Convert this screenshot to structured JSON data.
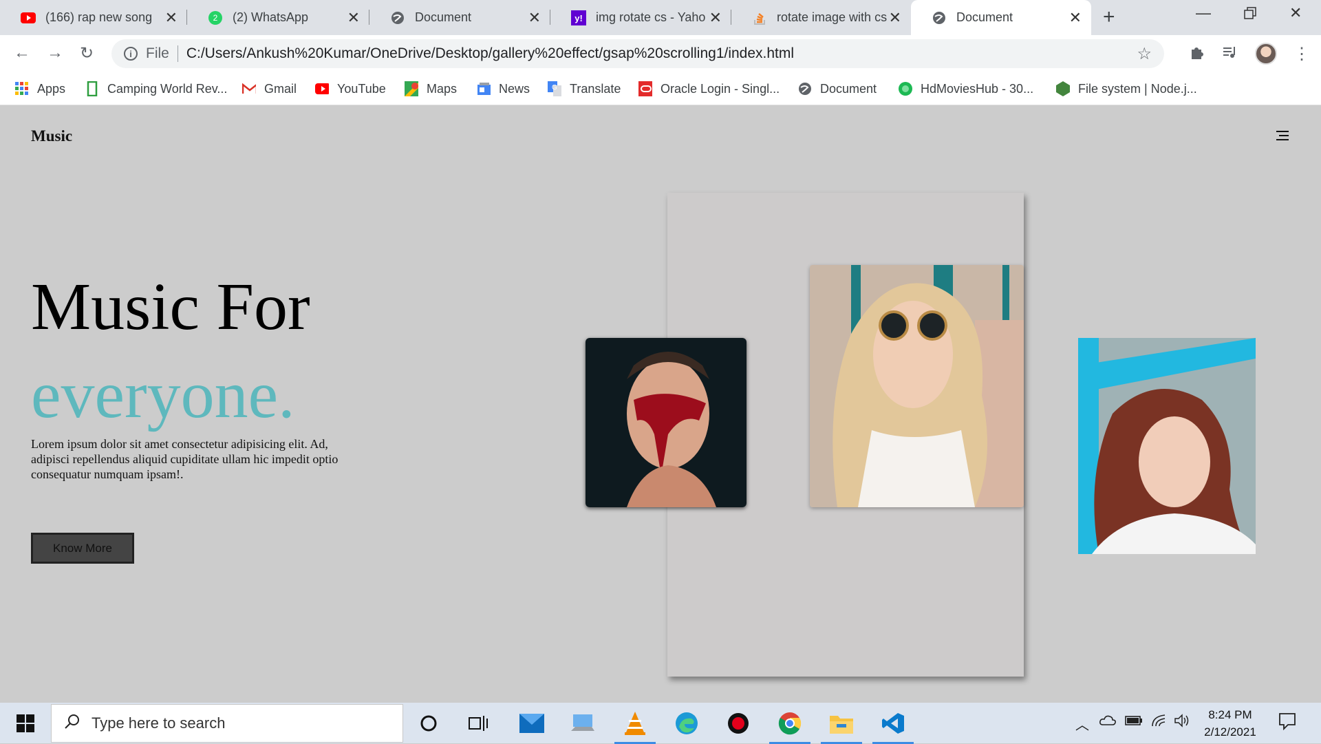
{
  "browser": {
    "tabs": [
      {
        "title": "(166) rap new song -",
        "icon": "youtube-icon"
      },
      {
        "title": "(2) WhatsApp",
        "icon": "whatsapp-icon"
      },
      {
        "title": "Document",
        "icon": "globe-icon"
      },
      {
        "title": "img rotate cs - Yahoo",
        "icon": "yahoo-icon"
      },
      {
        "title": "rotate image with css",
        "icon": "stackoverflow-icon"
      },
      {
        "title": "Document",
        "icon": "globe-icon",
        "active": true
      }
    ],
    "address": {
      "scheme_label": "File",
      "url": "C:/Users/Ankush%20Kumar/OneDrive/Desktop/gallery%20effect/gsap%20scrolling1/index.html"
    },
    "bookmarks": [
      {
        "label": "Apps",
        "icon": "apps-grid-icon"
      },
      {
        "label": "Camping World Rev...",
        "icon": "camping-icon"
      },
      {
        "label": "Gmail",
        "icon": "gmail-icon"
      },
      {
        "label": "YouTube",
        "icon": "youtube-icon"
      },
      {
        "label": "Maps",
        "icon": "maps-icon"
      },
      {
        "label": "News",
        "icon": "news-icon"
      },
      {
        "label": "Translate",
        "icon": "translate-icon"
      },
      {
        "label": "Oracle Login - Singl...",
        "icon": "oracle-icon"
      },
      {
        "label": "Document",
        "icon": "globe-icon"
      },
      {
        "label": "HdMoviesHub - 30...",
        "icon": "hdmovies-icon"
      },
      {
        "label": "File system | Node.j...",
        "icon": "nodejs-icon"
      }
    ]
  },
  "page": {
    "logo": "Music",
    "heading_line1": "Music For",
    "heading_line2": "everyone.",
    "paragraph": "Lorem ipsum dolor sit amet consectetur adipisicing elit. Ad, adipisci repellendus aliquid cupiditate ullam hic impedit optio consequatur numquam ipsam!.",
    "button_label": "Know More",
    "accent_color": "#5eb8bd",
    "background_color": "#cccccc"
  },
  "taskbar": {
    "search_placeholder": "Type here to search",
    "time": "8:24 PM",
    "date": "2/12/2021"
  }
}
